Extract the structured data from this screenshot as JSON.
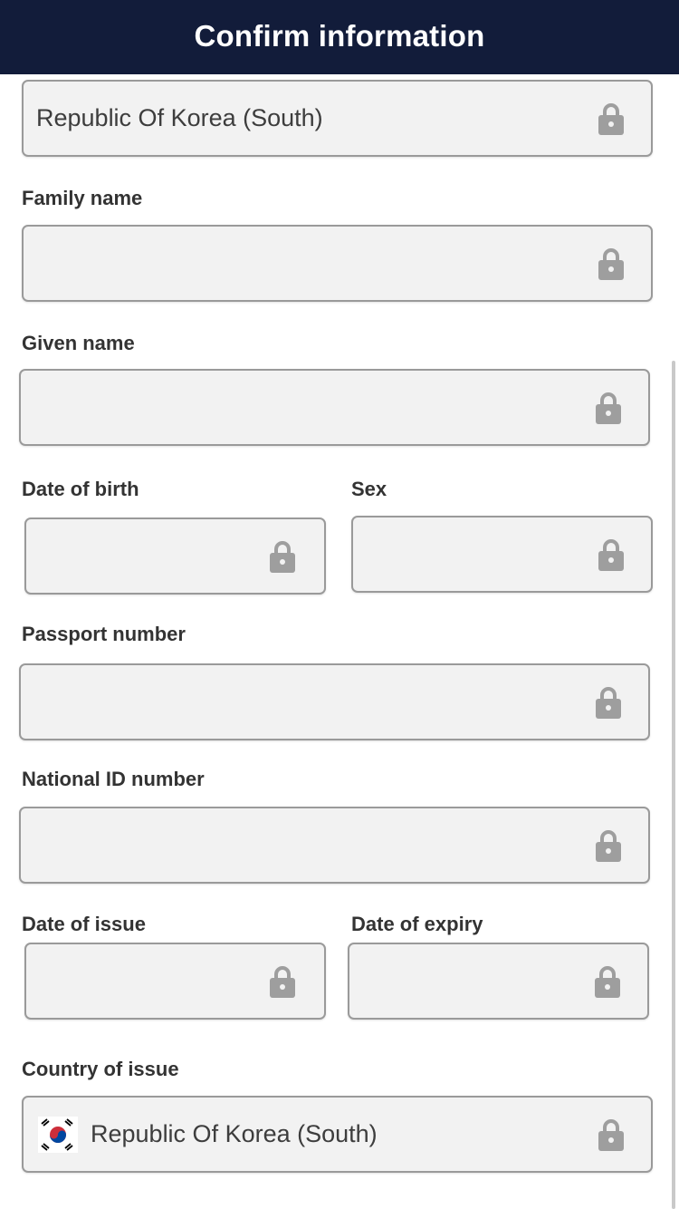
{
  "header": {
    "title": "Confirm information"
  },
  "fields": {
    "nationality": {
      "value": "Republic Of Korea (South)",
      "icon": "lock-icon"
    },
    "family_name": {
      "label": "Family name",
      "value": ""
    },
    "given_name": {
      "label": "Given name",
      "value": ""
    },
    "date_of_birth": {
      "label": "Date of birth",
      "value": ""
    },
    "sex": {
      "label": "Sex",
      "value": ""
    },
    "passport_number": {
      "label": "Passport number",
      "value": ""
    },
    "national_id_number": {
      "label": "National ID number",
      "value": ""
    },
    "date_of_issue": {
      "label": "Date of issue",
      "value": ""
    },
    "date_of_expiry": {
      "label": "Date of expiry",
      "value": ""
    },
    "country_of_issue": {
      "label": "Country of issue",
      "value": "Republic Of Korea (South)",
      "flag_icon": "south-korea-flag-icon"
    }
  },
  "colors": {
    "header_bg": "#121c3a",
    "field_bg": "#f2f2f2",
    "field_border": "#9a9a9a",
    "lock": "#9e9e9e"
  }
}
